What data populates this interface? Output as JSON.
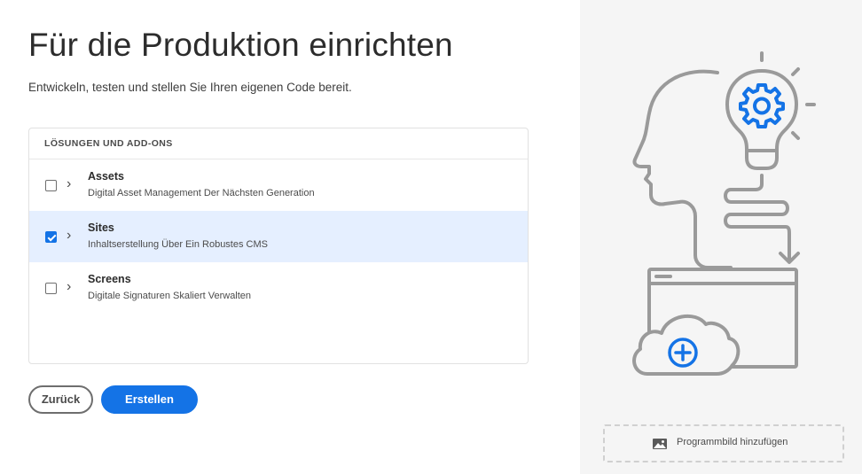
{
  "page": {
    "title": "Für die Produktion einrichten",
    "subtitle": "Entwickeln, testen und stellen Sie Ihren eigenen Code bereit."
  },
  "solutions": {
    "header": "LÖSUNGEN UND ADD-ONS",
    "items": [
      {
        "name": "Assets",
        "description": "Digital Asset Management Der Nächsten Generation",
        "checked": false
      },
      {
        "name": "Sites",
        "description": "Inhaltserstellung Über Ein Robustes CMS",
        "checked": true
      },
      {
        "name": "Screens",
        "description": "Digitale Signaturen Skaliert Verwalten",
        "checked": false
      }
    ]
  },
  "buttons": {
    "back_label": "Zurück",
    "create_label": "Erstellen"
  },
  "illustration": {
    "icons": [
      "head-lightbulb-gear-illustration",
      "cloud-plus-icon"
    ],
    "accent_color": "#1473e6"
  },
  "add_image": {
    "label": "Programmbild hinzufügen",
    "icon": "image-icon"
  }
}
